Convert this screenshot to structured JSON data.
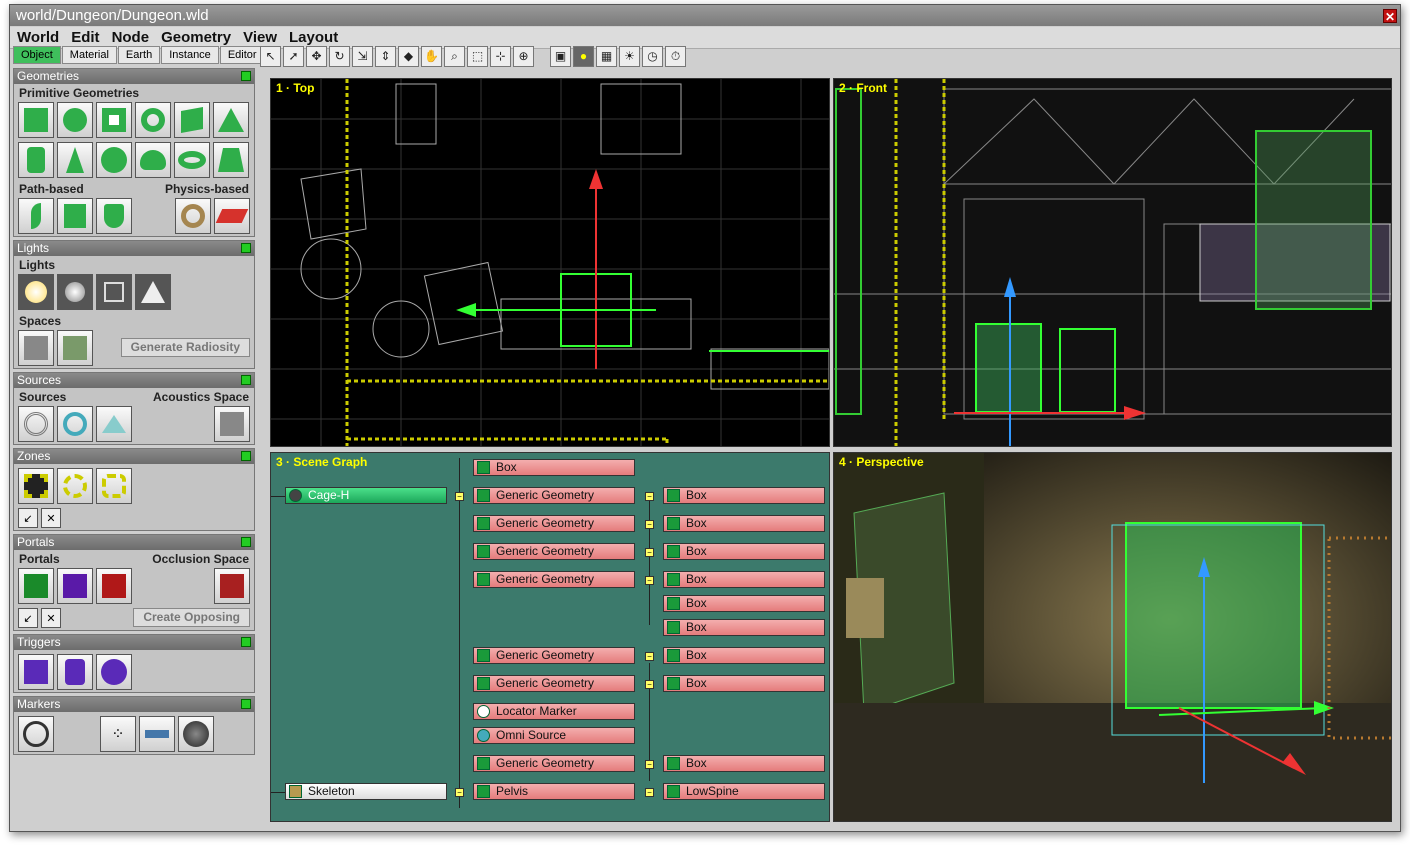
{
  "window": {
    "title": "world/Dungeon/Dungeon.wld"
  },
  "menu": [
    "World",
    "Edit",
    "Node",
    "Geometry",
    "View",
    "Layout"
  ],
  "left_tabs": [
    "Object",
    "Material",
    "Earth",
    "Instance",
    "Editor"
  ],
  "panels": {
    "geometries": {
      "title": "Geometries",
      "primitive": "Primitive Geometries",
      "path": "Path-based",
      "physics": "Physics-based"
    },
    "lights": {
      "title": "Lights",
      "sub": "Lights",
      "spaces": "Spaces",
      "generate": "Generate Radiosity"
    },
    "sources": {
      "title": "Sources",
      "sub": "Sources",
      "acoustics": "Acoustics Space"
    },
    "zones": {
      "title": "Zones"
    },
    "portals": {
      "title": "Portals",
      "sub": "Portals",
      "occlusion": "Occlusion Space",
      "create": "Create Opposing"
    },
    "triggers": {
      "title": "Triggers"
    },
    "markers": {
      "title": "Markers"
    }
  },
  "viewports": {
    "top": "1 · Top",
    "front": "2 · Front",
    "scene": "3 · Scene Graph",
    "persp": "4 · Perspective"
  },
  "scene_graph": {
    "root": "Cage-H",
    "skeleton": "Skeleton",
    "children": [
      "Box",
      "Generic Geometry",
      "Generic Geometry",
      "Generic Geometry",
      "Generic Geometry",
      "Generic Geometry",
      "Generic Geometry",
      "Locator Marker",
      "Omni Source",
      "Generic Geometry",
      "Pelvis"
    ],
    "leaves": [
      "Box",
      "Box",
      "Box",
      "Box",
      "Box",
      "Box",
      "Box",
      "Box",
      "Box",
      "LowSpine"
    ]
  },
  "colors": {
    "accent": "#3fbf5c",
    "node": "#e57c7c",
    "scene_bg": "#3c7a6c"
  }
}
